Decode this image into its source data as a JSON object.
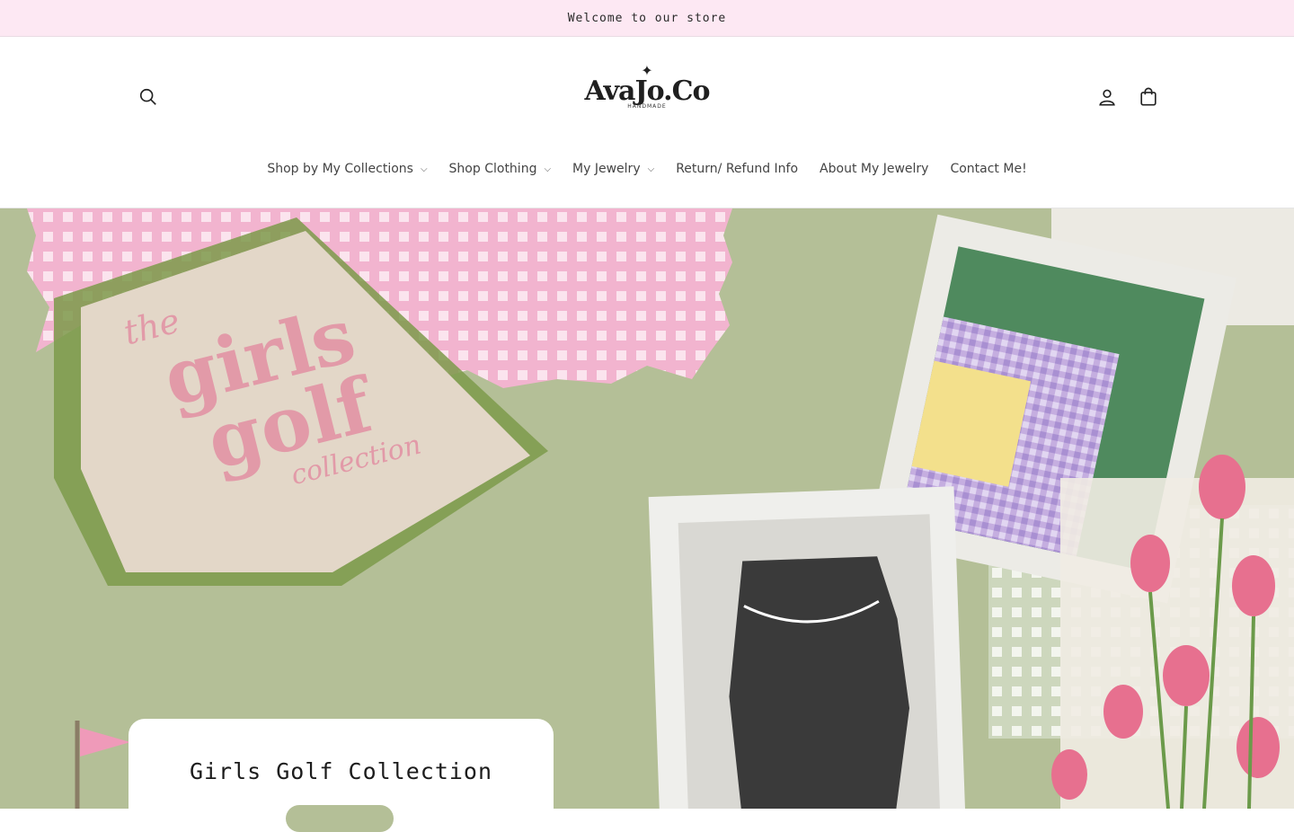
{
  "announcement": {
    "text": "Welcome to our store"
  },
  "header": {
    "logo": {
      "name": "AvaJo.Co",
      "tagline": "HANDMADE"
    },
    "icons": {
      "search": "search-icon",
      "account": "user-icon",
      "cart": "bag-icon"
    }
  },
  "nav": {
    "items": [
      {
        "label": "Shop by My Collections",
        "has_dropdown": true
      },
      {
        "label": "Shop Clothing",
        "has_dropdown": true
      },
      {
        "label": "My Jewelry",
        "has_dropdown": true
      },
      {
        "label": "Return/ Refund Info",
        "has_dropdown": false
      },
      {
        "label": "About My Jewelry",
        "has_dropdown": false
      },
      {
        "label": "Contact Me!",
        "has_dropdown": false
      }
    ]
  },
  "hero": {
    "image_text": {
      "line1": "the",
      "line2": "girls",
      "line3": "golf",
      "line4": "collection"
    },
    "card_title": "Girls Golf Collection"
  },
  "colors": {
    "announcement_bg": "#fde8f3",
    "hero_bg": "#b4bf97",
    "accent_pink": "#e9a6bf"
  }
}
